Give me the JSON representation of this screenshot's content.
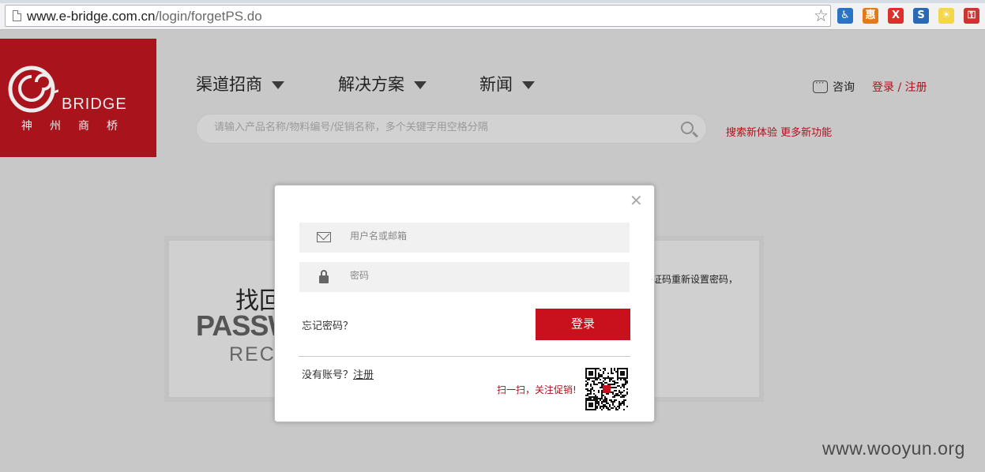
{
  "browser": {
    "url_host": "www.e-bridge.com.cn",
    "url_path": "/login/forgetPS.do",
    "extensions": [
      {
        "icon": "accessibility-icon",
        "color": "#2b73c5",
        "glyph": "♿"
      },
      {
        "icon": "hui-icon",
        "color": "#e07a1a",
        "glyph": "惠"
      },
      {
        "icon": "x-icon",
        "color": "#d9312b",
        "glyph": "X"
      },
      {
        "icon": "s-icon",
        "color": "#2a6ab5",
        "glyph": "S"
      },
      {
        "icon": "sun-icon",
        "color": "#f3d64a",
        "glyph": "☀"
      },
      {
        "icon": "key-icon",
        "color": "#c33",
        "glyph": "⚿"
      }
    ]
  },
  "logo": {
    "word": "BRIDGE",
    "cn": "神州商桥"
  },
  "nav": [
    "渠道招商",
    "解决方案",
    "新闻"
  ],
  "header": {
    "consult": "咨询",
    "login_register": "登录 / 注册"
  },
  "search": {
    "placeholder": "请输入产品名称/物料编号/促销名称，多个关键字用空格分隔",
    "promo": "搜索新体验 更多新功能"
  },
  "background": {
    "title": "找回",
    "pass": "PASSW",
    "reco": "RECO",
    "text": "证码重新设置密码，"
  },
  "modal": {
    "username_placeholder": "用户名或邮箱",
    "password_placeholder": "密码",
    "forgot": "忘记密码？",
    "login_button": "登录",
    "no_account": "没有账号？",
    "register": "注册",
    "scan": "扫一扫，关注促销!"
  },
  "watermark": "www.wooyun.org",
  "colors": {
    "brand_red": "#a9131c",
    "button_red": "#c8111c"
  }
}
